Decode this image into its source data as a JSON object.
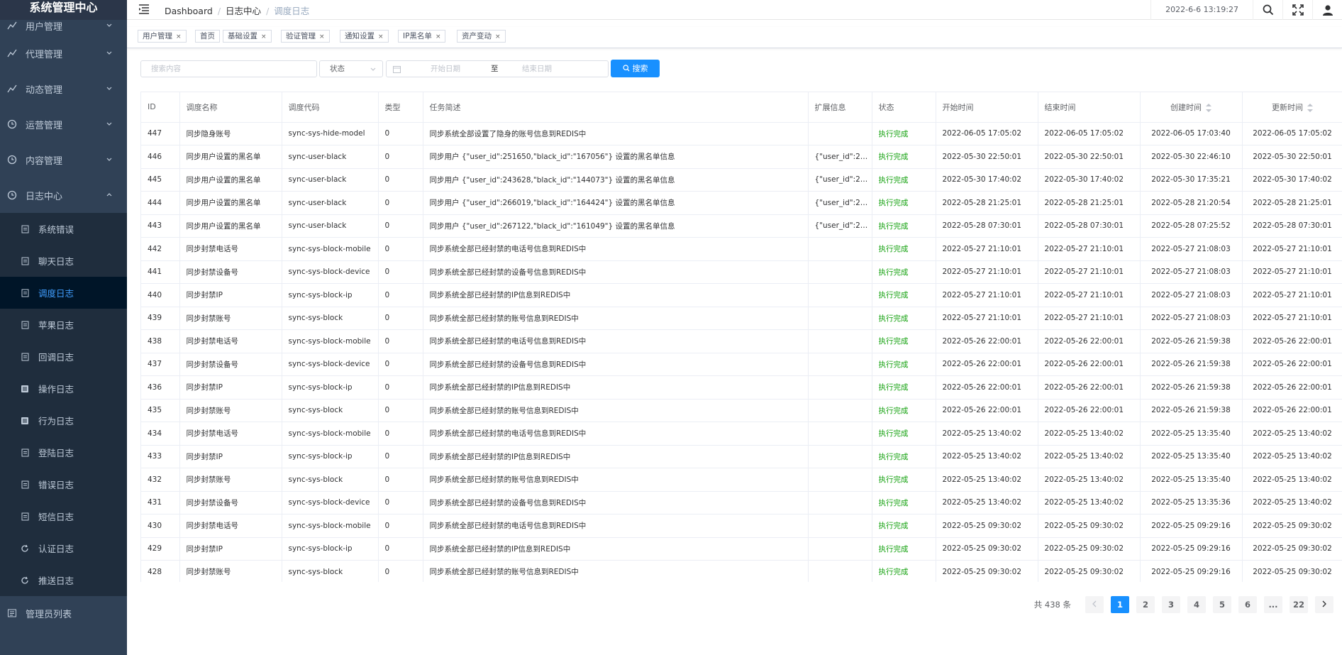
{
  "sidebar": {
    "title": "系统管理中心",
    "menus": [
      {
        "label": "用户管理",
        "icon": "chart-line-icon"
      },
      {
        "label": "代理管理",
        "icon": "chart-line-icon"
      },
      {
        "label": "动态管理",
        "icon": "chart-line-icon"
      },
      {
        "label": "运营管理",
        "icon": "clock-icon"
      },
      {
        "label": "内容管理",
        "icon": "clock-icon"
      },
      {
        "label": "日志中心",
        "icon": "clock-icon"
      }
    ],
    "log_items": [
      {
        "label": "系统错误",
        "icon": "document-icon"
      },
      {
        "label": "聊天日志",
        "icon": "document-icon"
      },
      {
        "label": "调度日志",
        "icon": "document-icon"
      },
      {
        "label": "苹果日志",
        "icon": "document-icon"
      },
      {
        "label": "回调日志",
        "icon": "document-icon"
      },
      {
        "label": "操作日志",
        "icon": "database-icon"
      },
      {
        "label": "行为日志",
        "icon": "database-icon"
      },
      {
        "label": "登陆日志",
        "icon": "document-icon"
      },
      {
        "label": "错误日志",
        "icon": "document-icon"
      },
      {
        "label": "短信日志",
        "icon": "document-icon"
      },
      {
        "label": "认证日志",
        "icon": "refresh-icon"
      },
      {
        "label": "推送日志",
        "icon": "refresh-icon"
      }
    ],
    "admin_label": "管理员列表",
    "active_color": "#409eff",
    "bg_color": "#304156"
  },
  "header": {
    "breadcrumb": [
      "Dashboard",
      "日志中心",
      "调度日志"
    ],
    "time": "2022-6-6 13:19:27"
  },
  "tags": [
    "用户管理",
    "首页",
    "基础设置",
    "验证管理",
    "通知设置",
    "IP黑名单",
    "资产变动"
  ],
  "filter": {
    "search_placeholder": "搜索内容",
    "status_placeholder": "状态",
    "start_placeholder": "开始日期",
    "range_sep": "至",
    "end_placeholder": "结束日期",
    "search_button": "搜索"
  },
  "table": {
    "columns": [
      "ID",
      "调度名称",
      "调度代码",
      "类型",
      "任务简述",
      "扩展信息",
      "状态",
      "开始时间",
      "结束时间",
      "创建时间",
      "更新时间"
    ],
    "rows": [
      [
        "447",
        "同步隐身账号",
        "sync-sys-hide-model",
        "0",
        "同步系统全部设置了隐身的账号信息到REDIS中",
        "",
        "执行完成",
        "2022-06-05 17:05:02",
        "2022-06-05 17:05:02",
        "2022-06-05 17:03:40",
        "2022-06-05 17:05:02"
      ],
      [
        "446",
        "同步用户设置的黑名单",
        "sync-user-black",
        "0",
        "同步用户 {\"user_id\":251650,\"black_id\":\"167056\"} 设置的黑名单信息",
        "{\"user_id\":2…",
        "执行完成",
        "2022-05-30 22:50:01",
        "2022-05-30 22:50:01",
        "2022-05-30 22:46:10",
        "2022-05-30 22:50:01"
      ],
      [
        "445",
        "同步用户设置的黑名单",
        "sync-user-black",
        "0",
        "同步用户 {\"user_id\":243628,\"black_id\":\"144073\"} 设置的黑名单信息",
        "{\"user_id\":2…",
        "执行完成",
        "2022-05-30 17:40:02",
        "2022-05-30 17:40:02",
        "2022-05-30 17:35:21",
        "2022-05-30 17:40:02"
      ],
      [
        "444",
        "同步用户设置的黑名单",
        "sync-user-black",
        "0",
        "同步用户 {\"user_id\":266019,\"black_id\":\"164424\"} 设置的黑名单信息",
        "{\"user_id\":2…",
        "执行完成",
        "2022-05-28 21:25:01",
        "2022-05-28 21:25:01",
        "2022-05-28 21:20:54",
        "2022-05-28 21:25:01"
      ],
      [
        "443",
        "同步用户设置的黑名单",
        "sync-user-black",
        "0",
        "同步用户 {\"user_id\":267122,\"black_id\":\"161049\"} 设置的黑名单信息",
        "{\"user_id\":2…",
        "执行完成",
        "2022-05-28 07:30:01",
        "2022-05-28 07:30:01",
        "2022-05-28 07:25:52",
        "2022-05-28 07:30:01"
      ],
      [
        "442",
        "同步封禁电话号",
        "sync-sys-block-mobile",
        "0",
        "同步系统全部已经封禁的电话号信息到REDIS中",
        "",
        "执行完成",
        "2022-05-27 21:10:01",
        "2022-05-27 21:10:01",
        "2022-05-27 21:08:03",
        "2022-05-27 21:10:01"
      ],
      [
        "441",
        "同步封禁设备号",
        "sync-sys-block-device",
        "0",
        "同步系统全部已经封禁的设备号信息到REDIS中",
        "",
        "执行完成",
        "2022-05-27 21:10:01",
        "2022-05-27 21:10:01",
        "2022-05-27 21:08:03",
        "2022-05-27 21:10:01"
      ],
      [
        "440",
        "同步封禁IP",
        "sync-sys-block-ip",
        "0",
        "同步系统全部已经封禁的IP信息到REDIS中",
        "",
        "执行完成",
        "2022-05-27 21:10:01",
        "2022-05-27 21:10:01",
        "2022-05-27 21:08:03",
        "2022-05-27 21:10:01"
      ],
      [
        "439",
        "同步封禁账号",
        "sync-sys-block",
        "0",
        "同步系统全部已经封禁的账号信息到REDIS中",
        "",
        "执行完成",
        "2022-05-27 21:10:01",
        "2022-05-27 21:10:01",
        "2022-05-27 21:08:03",
        "2022-05-27 21:10:01"
      ],
      [
        "438",
        "同步封禁电话号",
        "sync-sys-block-mobile",
        "0",
        "同步系统全部已经封禁的电话号信息到REDIS中",
        "",
        "执行完成",
        "2022-05-26 22:00:01",
        "2022-05-26 22:00:01",
        "2022-05-26 21:59:38",
        "2022-05-26 22:00:01"
      ],
      [
        "437",
        "同步封禁设备号",
        "sync-sys-block-device",
        "0",
        "同步系统全部已经封禁的设备号信息到REDIS中",
        "",
        "执行完成",
        "2022-05-26 22:00:01",
        "2022-05-26 22:00:01",
        "2022-05-26 21:59:38",
        "2022-05-26 22:00:01"
      ],
      [
        "436",
        "同步封禁IP",
        "sync-sys-block-ip",
        "0",
        "同步系统全部已经封禁的IP信息到REDIS中",
        "",
        "执行完成",
        "2022-05-26 22:00:01",
        "2022-05-26 22:00:01",
        "2022-05-26 21:59:38",
        "2022-05-26 22:00:01"
      ],
      [
        "435",
        "同步封禁账号",
        "sync-sys-block",
        "0",
        "同步系统全部已经封禁的账号信息到REDIS中",
        "",
        "执行完成",
        "2022-05-26 22:00:01",
        "2022-05-26 22:00:01",
        "2022-05-26 21:59:38",
        "2022-05-26 22:00:01"
      ],
      [
        "434",
        "同步封禁电话号",
        "sync-sys-block-mobile",
        "0",
        "同步系统全部已经封禁的电话号信息到REDIS中",
        "",
        "执行完成",
        "2022-05-25 13:40:02",
        "2022-05-25 13:40:02",
        "2022-05-25 13:35:40",
        "2022-05-25 13:40:02"
      ],
      [
        "433",
        "同步封禁IP",
        "sync-sys-block-ip",
        "0",
        "同步系统全部已经封禁的IP信息到REDIS中",
        "",
        "执行完成",
        "2022-05-25 13:40:02",
        "2022-05-25 13:40:02",
        "2022-05-25 13:35:40",
        "2022-05-25 13:40:02"
      ],
      [
        "432",
        "同步封禁账号",
        "sync-sys-block",
        "0",
        "同步系统全部已经封禁的账号信息到REDIS中",
        "",
        "执行完成",
        "2022-05-25 13:40:02",
        "2022-05-25 13:40:02",
        "2022-05-25 13:35:40",
        "2022-05-25 13:40:02"
      ],
      [
        "431",
        "同步封禁设备号",
        "sync-sys-block-device",
        "0",
        "同步系统全部已经封禁的设备号信息到REDIS中",
        "",
        "执行完成",
        "2022-05-25 13:40:02",
        "2022-05-25 13:40:02",
        "2022-05-25 13:35:36",
        "2022-05-25 13:40:02"
      ],
      [
        "430",
        "同步封禁电话号",
        "sync-sys-block-mobile",
        "0",
        "同步系统全部已经封禁的电话号信息到REDIS中",
        "",
        "执行完成",
        "2022-05-25 09:30:02",
        "2022-05-25 09:30:02",
        "2022-05-25 09:29:16",
        "2022-05-25 09:30:02"
      ],
      [
        "429",
        "同步封禁IP",
        "sync-sys-block-ip",
        "0",
        "同步系统全部已经封禁的IP信息到REDIS中",
        "",
        "执行完成",
        "2022-05-25 09:30:02",
        "2022-05-25 09:30:02",
        "2022-05-25 09:29:16",
        "2022-05-25 09:30:02"
      ],
      [
        "428",
        "同步封禁账号",
        "sync-sys-block",
        "0",
        "同步系统全部已经封禁的账号信息到REDIS中",
        "",
        "执行完成",
        "2022-05-25 09:30:02",
        "2022-05-25 09:30:02",
        "2022-05-25 09:29:16",
        "2022-05-25 09:30:02"
      ]
    ],
    "status_color": "#13a10e"
  },
  "pagination": {
    "total_text": "共 438 条",
    "pages": [
      "1",
      "2",
      "3",
      "4",
      "5",
      "6",
      "...",
      "22"
    ],
    "current": "1",
    "accent": "#1890ff"
  }
}
